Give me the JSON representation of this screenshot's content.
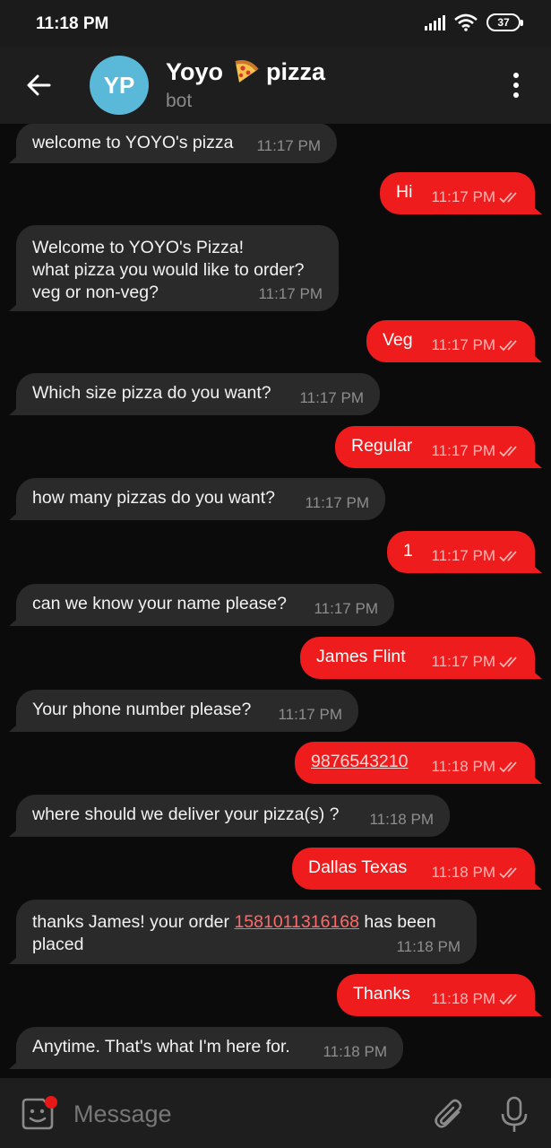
{
  "status_bar": {
    "time": "11:18 PM",
    "battery": "37"
  },
  "header": {
    "avatar_initials": "YP",
    "title_part1": "Yoyo",
    "title_part2": "pizza",
    "subtitle": "bot"
  },
  "messages": [
    {
      "dir": "in",
      "text": "welcome to YOYO's pizza",
      "time": "11:17 PM"
    },
    {
      "dir": "out",
      "text": "Hi",
      "time": "11:17 PM"
    },
    {
      "dir": "in",
      "text": "Welcome to YOYO's Pizza!\nwhat pizza you would like to order?\nveg or non-veg?",
      "time": "11:17 PM"
    },
    {
      "dir": "out",
      "text": "Veg",
      "time": "11:17 PM"
    },
    {
      "dir": "in",
      "text": "Which size pizza do you want?",
      "time": "11:17 PM"
    },
    {
      "dir": "out",
      "text": "Regular",
      "time": "11:17 PM"
    },
    {
      "dir": "in",
      "text": "how many pizzas do you want?",
      "time": "11:17 PM"
    },
    {
      "dir": "out",
      "text": "1",
      "time": "11:17 PM"
    },
    {
      "dir": "in",
      "text": "can we know your name please?",
      "time": "11:17 PM"
    },
    {
      "dir": "out",
      "text": "James Flint",
      "time": "11:17 PM"
    },
    {
      "dir": "in",
      "text": "Your phone number please?",
      "time": "11:17 PM"
    },
    {
      "dir": "out",
      "link": "9876543210",
      "time": "11:18 PM"
    },
    {
      "dir": "in",
      "text": "where should we deliver your pizza(s) ?",
      "time": "11:18 PM"
    },
    {
      "dir": "out",
      "text": "Dallas Texas",
      "time": "11:18 PM"
    },
    {
      "dir": "in",
      "text": "thanks James! your order ",
      "link": "1581011316168",
      "text_after": " has been\nplaced",
      "time": "11:18 PM"
    },
    {
      "dir": "out",
      "text": "Thanks",
      "time": "11:18 PM"
    },
    {
      "dir": "in",
      "text": "Anytime. That's what I'm here for.",
      "time": "11:18 PM"
    }
  ],
  "composer": {
    "placeholder": "Message"
  },
  "colors": {
    "outgoing_bubble": "#ee1c1c",
    "incoming_bubble": "#2a2a2a",
    "avatar": "#5ab8d8",
    "background": "#0b0b0b"
  }
}
